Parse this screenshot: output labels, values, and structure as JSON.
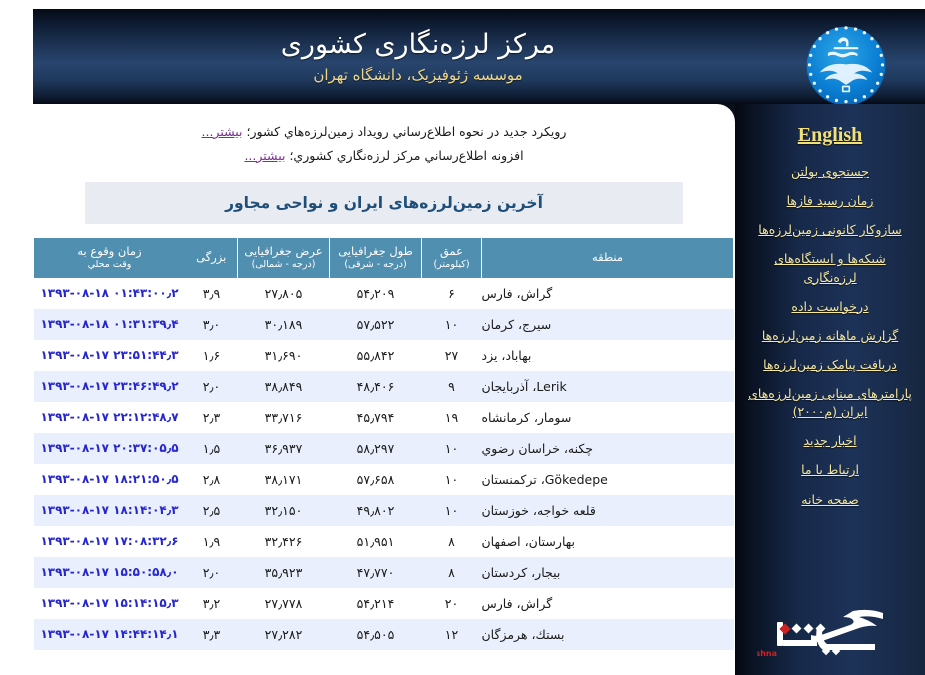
{
  "header": {
    "title": "مرکز لرزه‌نگاری کشوری",
    "subtitle": "موسسه ژئوفیزیک، دانشگاه تهران",
    "logo_name": "university-of-tehran-seal"
  },
  "announcements": [
    {
      "text": "رویکرد جدید در نحوه اطلاع‌رساني رویداد زمین‌لرزه‌هاي کشور؛",
      "link": "بیشتر..."
    },
    {
      "text": "افزونه اطلاع‌رساني مرکز لرزه‌نگاري کشوري؛",
      "link": "بیشتر..."
    }
  ],
  "section": {
    "title": "آخرین زمین‌لرزه‌های ایران و نواحی مجاور"
  },
  "table": {
    "headers": [
      {
        "main": "منطقه",
        "sub": ""
      },
      {
        "main": "عمق",
        "sub": "(کیلومتر)"
      },
      {
        "main": "طول جغرافیایی",
        "sub": "(درجه - شرقی)"
      },
      {
        "main": "عرض جغرافیایی",
        "sub": "(درجه - شمالی)"
      },
      {
        "main": "بزرگی",
        "sub": ""
      },
      {
        "main": "زمان وقوع به",
        "sub": "وقت محلي"
      }
    ],
    "rows": [
      {
        "region": "گراش، فارس",
        "depth": "۶",
        "lon": "۵۴٫۲۰۹",
        "lat": "۲۷٫۸۰۵",
        "mag": "۳٫۹",
        "datetime": "۱۳۹۳-۰۸-۱۸ ۰۱:۴۳:۰۰٫۲",
        "highlight": true
      },
      {
        "region": "سیرج، کرمان",
        "depth": "۱۰",
        "lon": "۵۷٫۵۲۲",
        "lat": "۳۰٫۱۸۹",
        "mag": "۳٫۰",
        "datetime": "۱۳۹۳-۰۸-۱۸ ۰۱:۳۱:۳۹٫۴",
        "highlight": true
      },
      {
        "region": "بهاباد، یزد",
        "depth": "۲۷",
        "lon": "۵۵٫۸۴۲",
        "lat": "۳۱٫۶۹۰",
        "mag": "۱٫۶",
        "datetime": "۱۳۹۳-۰۸-۱۷ ۲۳:۵۱:۴۴٫۳",
        "highlight": false
      },
      {
        "region": "Lerik، آذربایجان",
        "depth": "۹",
        "lon": "۴۸٫۴۰۶",
        "lat": "۳۸٫۸۴۹",
        "mag": "۲٫۰",
        "datetime": "۱۳۹۳-۰۸-۱۷ ۲۳:۴۶:۴۹٫۲",
        "highlight": false
      },
      {
        "region": "سومار، کرمانشاه",
        "depth": "۱۹",
        "lon": "۴۵٫۷۹۴",
        "lat": "۳۳٫۷۱۶",
        "mag": "۲٫۳",
        "datetime": "۱۳۹۳-۰۸-۱۷ ۲۲:۱۲:۴۸٫۷",
        "highlight": false
      },
      {
        "region": "چکنه، خراسان رضوي",
        "depth": "۱۰",
        "lon": "۵۸٫۲۹۷",
        "lat": "۳۶٫۹۳۷",
        "mag": "۱٫۵",
        "datetime": "۱۳۹۳-۰۸-۱۷ ۲۰:۳۷:۰۵٫۵",
        "highlight": false
      },
      {
        "region": "Gökedepe، ترکمنستان",
        "depth": "۱۰",
        "lon": "۵۷٫۶۵۸",
        "lat": "۳۸٫۱۷۱",
        "mag": "۲٫۸",
        "datetime": "۱۳۹۳-۰۸-۱۷ ۱۸:۲۱:۵۰٫۵",
        "highlight": false
      },
      {
        "region": "قلعه خواجه، خوزستان",
        "depth": "۱۰",
        "lon": "۴۹٫۸۰۲",
        "lat": "۳۲٫۱۵۰",
        "mag": "۲٫۵",
        "datetime": "۱۳۹۳-۰۸-۱۷ ۱۸:۱۴:۰۴٫۳",
        "highlight": false
      },
      {
        "region": "بهارستان، اصفهان",
        "depth": "۸",
        "lon": "۵۱٫۹۵۱",
        "lat": "۳۲٫۴۲۶",
        "mag": "۱٫۹",
        "datetime": "۱۳۹۳-۰۸-۱۷ ۱۷:۰۸:۳۲٫۶",
        "highlight": false
      },
      {
        "region": "بیجار، کردستان",
        "depth": "۸",
        "lon": "۴۷٫۷۷۰",
        "lat": "۳۵٫۹۲۳",
        "mag": "۲٫۰",
        "datetime": "۱۳۹۳-۰۸-۱۷ ۱۵:۵۰:۵۸٫۰",
        "highlight": false
      },
      {
        "region": "گراش، فارس",
        "depth": "۲۰",
        "lon": "۵۴٫۲۱۴",
        "lat": "۲۷٫۷۷۸",
        "mag": "۳٫۲",
        "datetime": "۱۳۹۳-۰۸-۱۷ ۱۵:۱۴:۱۵٫۳",
        "highlight": true
      },
      {
        "region": "بستك، هرمزگان",
        "depth": "۱۲",
        "lon": "۵۴٫۵۰۵",
        "lat": "۲۷٫۲۸۲",
        "mag": "۳٫۳",
        "datetime": "۱۳۹۳-۰۸-۱۷ ۱۴:۴۴:۱۴٫۱",
        "highlight": true
      }
    ]
  },
  "sidebar": {
    "english_label": "English",
    "items": [
      {
        "label": "جستجوی بولتن"
      },
      {
        "label": "زمان رسید فازها"
      },
      {
        "label": "سازوکار کانونی زمین‌لرزه‌ها"
      },
      {
        "label": "شبکه‌ها و ایستگاه‌های لرزه‌نگاری"
      },
      {
        "label": "درخواست داده"
      },
      {
        "label": "گزارش ماهانه زمین‌لرزه‌ها"
      },
      {
        "label": "دریافت پیامک زمین‌لرزه‌ها"
      },
      {
        "label": "پارامترهای مبنایی زمین‌لرزه‌های ایران (م۲۰۰۰)"
      },
      {
        "label": "اخبار جدید"
      },
      {
        "label": "ارتباط با ما"
      },
      {
        "label": "صفحه خانه"
      }
    ],
    "gerishna_logo_caption": "Gerishna"
  },
  "colors": {
    "header_blue": "#1d3354",
    "table_header": "#518fb0",
    "alt_row": "#e9effc",
    "highlight_text": "#e8491d",
    "datetime_text": "#2626cf",
    "link_yellow": "#f5e79e",
    "more_link_purple": "#7b2f8e",
    "section_title_blue": "#1f4e79",
    "subtitle_gold": "#f0d88a"
  }
}
